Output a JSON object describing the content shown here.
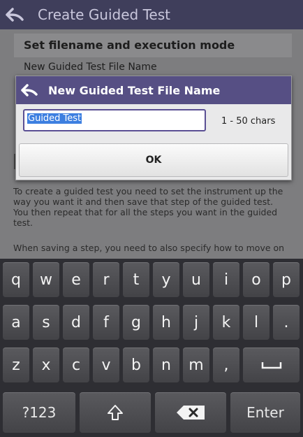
{
  "app": {
    "title": "Create Guided Test"
  },
  "background": {
    "section_title": "Set filename and execution mode",
    "field_label": "New Guided Test File Name",
    "paragraph1": "To create a guided test you need to set the instrument up the way you want it and then save that step of the guided test. You then repeat that for all the steps you want in the guided test.",
    "paragraph2": "When saving a step, you need to also specify how to move on"
  },
  "dialog": {
    "title": "New Guided Test File Name",
    "input_value": "Guided Test",
    "length_hint": "1 - 50 chars",
    "ok_label": "OK"
  },
  "keyboard": {
    "row1": [
      "q",
      "w",
      "e",
      "r",
      "t",
      "y",
      "u",
      "i",
      "o",
      "p"
    ],
    "row2": [
      "a",
      "s",
      "d",
      "f",
      "g",
      "h",
      "j",
      "k",
      "l",
      "."
    ],
    "row3": [
      "z",
      "x",
      "c",
      "v",
      "b",
      "n",
      "m",
      ","
    ],
    "numbers_label": "?123",
    "enter_label": "Enter"
  },
  "colors": {
    "titlebar": "#3f3e5b",
    "dialog_header": "#564f84",
    "selection": "#3d7fe0"
  }
}
